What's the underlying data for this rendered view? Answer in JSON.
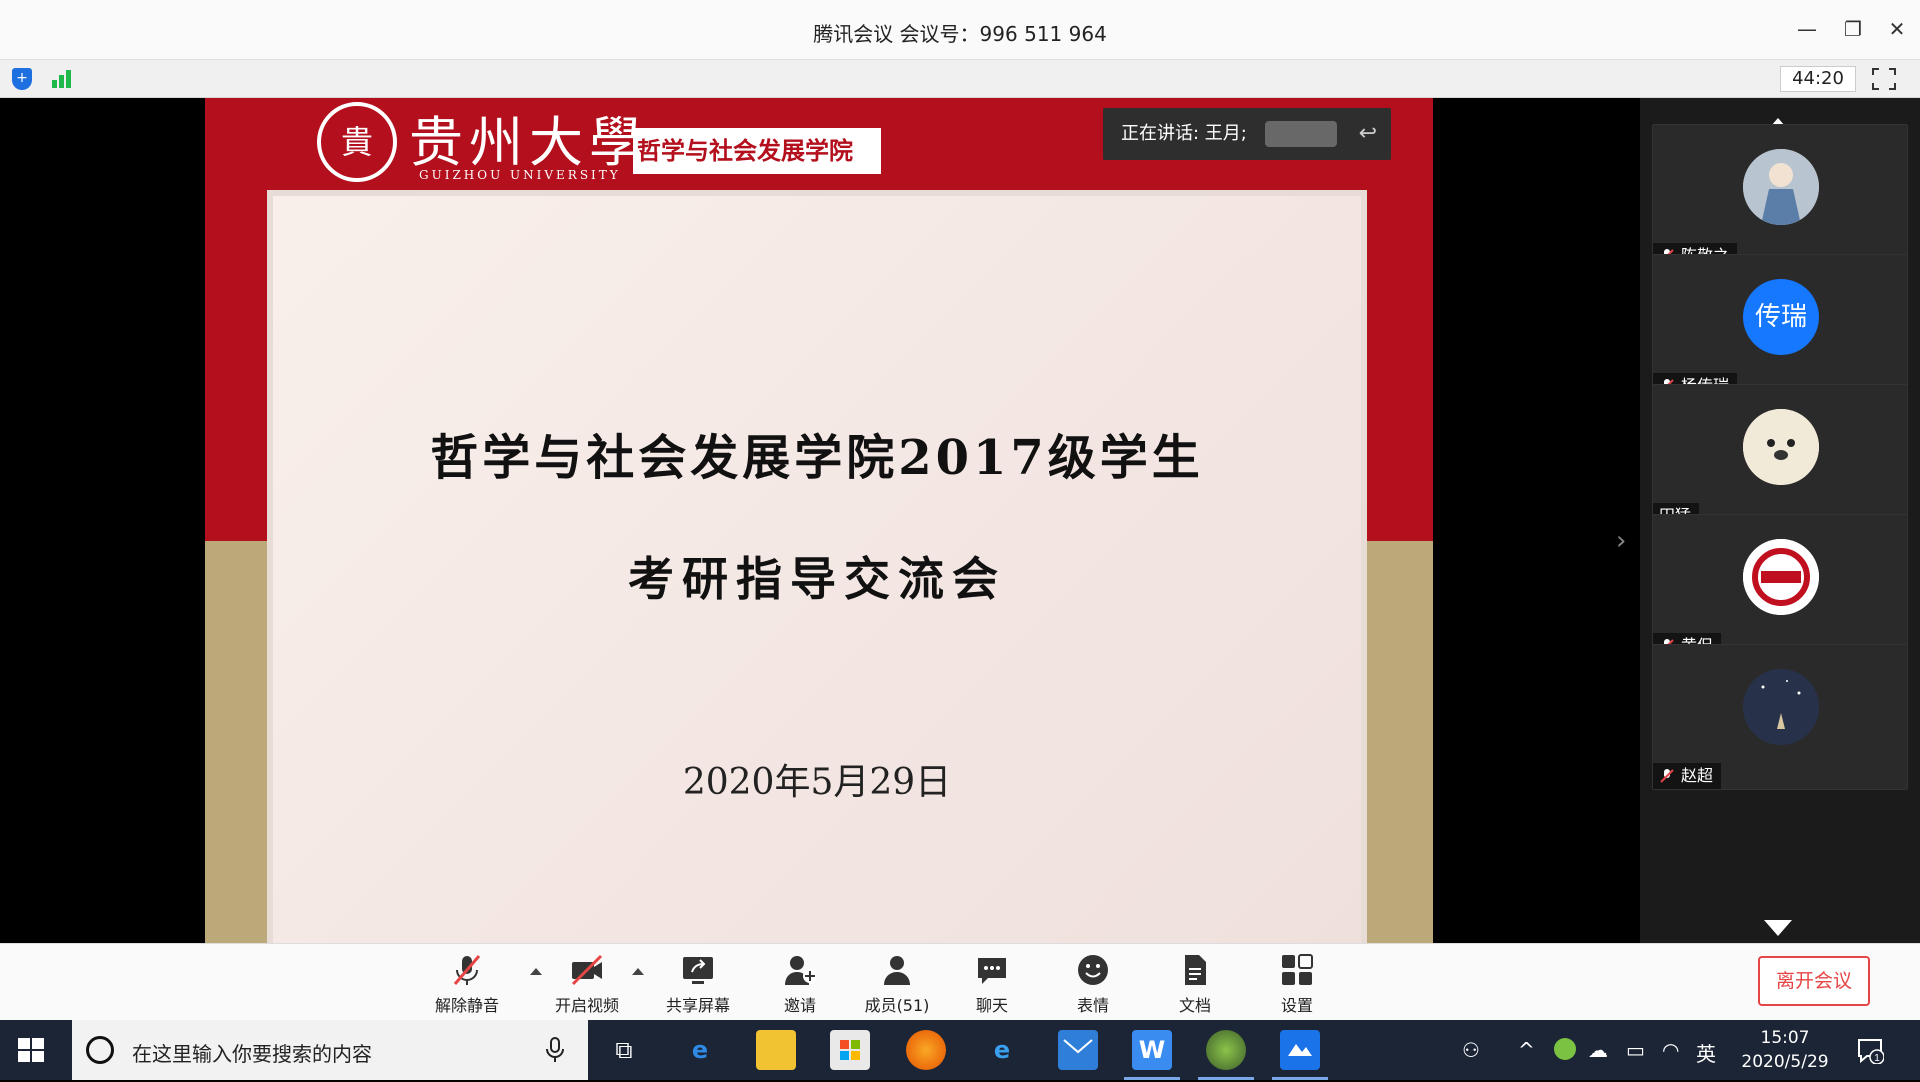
{
  "window": {
    "title": "腾讯会议 会议号：996 511 964",
    "timer": "44:20"
  },
  "slide": {
    "university_cn": "贵州大學",
    "university_en": "GUIZHOU UNIVERSITY",
    "seal_char": "貴",
    "college_tag": "哲学与社会发展学院",
    "speaking_label": "正在讲话: 王月;",
    "title_line1": "哲学与社会发展学院2017级学生",
    "title_line2": "考研指导交流会",
    "date": "2020年5月29日"
  },
  "participants": [
    {
      "name": "陈敬之",
      "muted": true,
      "avatar": "illustration"
    },
    {
      "name": "杨传瑞",
      "muted": true,
      "avatar_text": "传瑞",
      "avatar_color": "#1677ff"
    },
    {
      "name": "田猛",
      "muted": false,
      "avatar": "dog-photo"
    },
    {
      "name": "黄侃",
      "muted": true,
      "avatar": "logo"
    },
    {
      "name": "赵超",
      "muted": true,
      "avatar": "night-sky"
    }
  ],
  "controls": {
    "unmute": "解除静音",
    "start_video": "开启视频",
    "share_screen": "共享屏幕",
    "invite": "邀请",
    "members": "成员(51)",
    "chat": "聊天",
    "emoji": "表情",
    "docs": "文档",
    "settings": "设置",
    "leave": "离开会议"
  },
  "taskbar": {
    "search_placeholder": "在这里输入你要搜索的内容",
    "ime": "英",
    "time": "15:07",
    "date": "2020/5/29",
    "notification_count": "1"
  },
  "colors": {
    "slide_red": "#b30f1c",
    "slide_gold": "#bca97a",
    "accent_blue": "#1677ff",
    "leave_red": "#e54545"
  }
}
